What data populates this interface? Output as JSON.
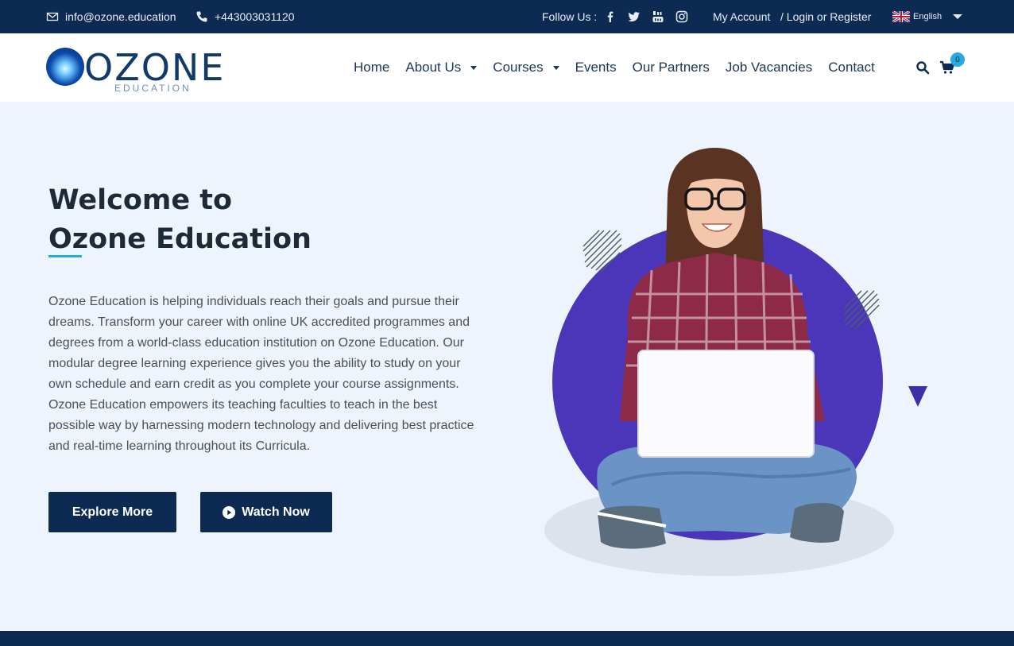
{
  "topbar": {
    "email": "info@ozone.education",
    "phone": "+443003031120",
    "follow_label": "Follow Us :",
    "social_icons": [
      "facebook-icon",
      "twitter-icon",
      "youtube-icon",
      "instagram-icon"
    ],
    "my_account": "My Account",
    "login": "/ Login or Register",
    "language": "English"
  },
  "header": {
    "logo_word": "OZONE",
    "logo_sub": "EDUCATION",
    "nav": [
      {
        "label": "Home"
      },
      {
        "label": "About Us"
      },
      {
        "label": "Courses"
      },
      {
        "label": "Events"
      },
      {
        "label": "Our Partners"
      },
      {
        "label": "Job Vacancies"
      },
      {
        "label": "Contact"
      }
    ],
    "cart_count": "0"
  },
  "hero": {
    "title_line1": "Welcome to",
    "title_line2": "Ozone Education",
    "paragraph": "Ozone Education is helping individuals reach their goals and pursue their dreams. Transform your career with online UK accredited programmes and degrees from a world-class education institution on Ozone Education. Our modular degree learning experience gives you the ability to study on your own schedule and earn credit as you complete your course assignments. Ozone Education empowers its teaching faculties to teach in the best possible way by harnessing modern technology and delivering best practice and real-time learning throughout its Curricula.",
    "explore_button": "Explore More",
    "watch_button": "Watch Now"
  },
  "colors": {
    "navy": "#0d2a52",
    "accent": "#27a9e1",
    "purple": "#4b35b8",
    "background": "#eef4fd"
  }
}
